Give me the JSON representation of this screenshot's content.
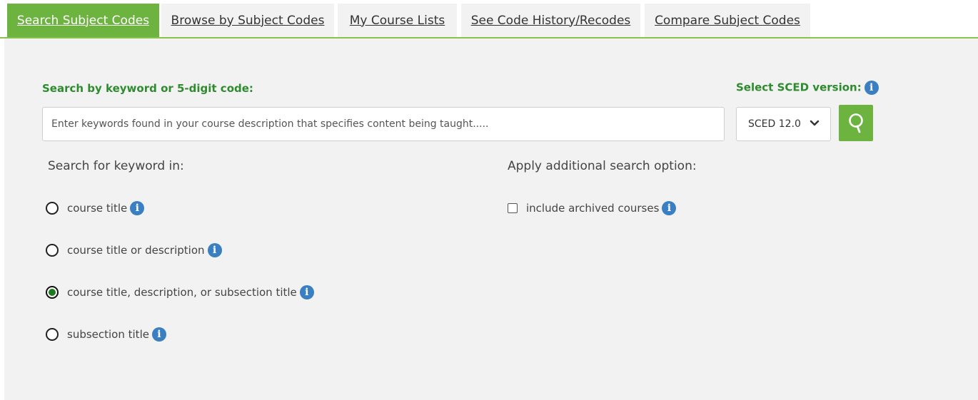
{
  "tabs": [
    {
      "label": "Search Subject Codes",
      "active": true
    },
    {
      "label": "Browse by Subject Codes",
      "active": false
    },
    {
      "label": "My Course Lists",
      "active": false
    },
    {
      "label": "See Code History/Recodes",
      "active": false
    },
    {
      "label": "Compare Subject Codes",
      "active": false
    }
  ],
  "search": {
    "label": "Search by keyword or 5-digit code:",
    "placeholder": "Enter keywords found in your course description that specifies content being taught.....",
    "value": ""
  },
  "version": {
    "label": "Select SCED version:",
    "selected": "SCED 12.0"
  },
  "keyword_scope": {
    "heading": "Search for keyword in:",
    "options": [
      {
        "label": "course title",
        "checked": false
      },
      {
        "label": "course title or description",
        "checked": false
      },
      {
        "label": "course title, description, or subsection title",
        "checked": true
      },
      {
        "label": "subsection title",
        "checked": false
      }
    ]
  },
  "additional": {
    "heading": "Apply additional search option:",
    "include_archived_label": "include archived courses",
    "include_archived_checked": false
  },
  "colors": {
    "accent": "#6db33f",
    "label_green": "#2e8b2e",
    "info_blue": "#3a7fc1",
    "panel_bg": "#f2f2f2"
  },
  "icons": {
    "search": "magnifier-icon",
    "info": "info-icon",
    "dropdown": "chevron-down-icon"
  }
}
